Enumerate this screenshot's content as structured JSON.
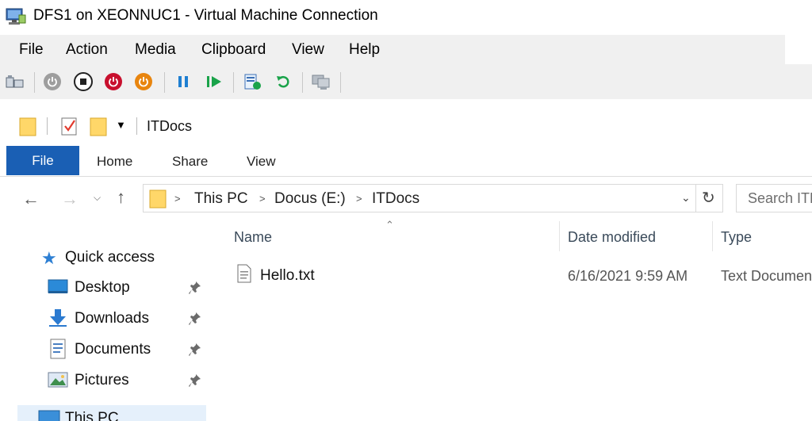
{
  "vm": {
    "title": "DFS1 on XEONNUC1 - Virtual Machine Connection",
    "menu": [
      "File",
      "Action",
      "Media",
      "Clipboard",
      "View",
      "Help"
    ]
  },
  "explorer": {
    "qat_title": "ITDocs",
    "tabs": {
      "file": "File",
      "home": "Home",
      "share": "Share",
      "view": "View"
    },
    "breadcrumb": [
      "This PC",
      "Docus (E:)",
      "ITDocs"
    ],
    "search_placeholder": "Search ITDocs",
    "columns": {
      "name": "Name",
      "date": "Date modified",
      "type": "Type"
    },
    "nav": {
      "quick_access": "Quick access",
      "items": [
        {
          "label": "Desktop",
          "icon": "desktop-icon"
        },
        {
          "label": "Downloads",
          "icon": "downloads-icon"
        },
        {
          "label": "Documents",
          "icon": "documents-icon"
        },
        {
          "label": "Pictures",
          "icon": "pictures-icon"
        }
      ],
      "this_pc": "This PC"
    },
    "files": [
      {
        "name": "Hello.txt",
        "date": "6/16/2021 9:59 AM",
        "type": "Text Document"
      }
    ]
  },
  "colors": {
    "file_tab": "#1a5fb4",
    "power_red": "#c8102e",
    "power_orange": "#e8850f",
    "play_green": "#1aa34a",
    "pause_blue": "#1f7fd1"
  }
}
